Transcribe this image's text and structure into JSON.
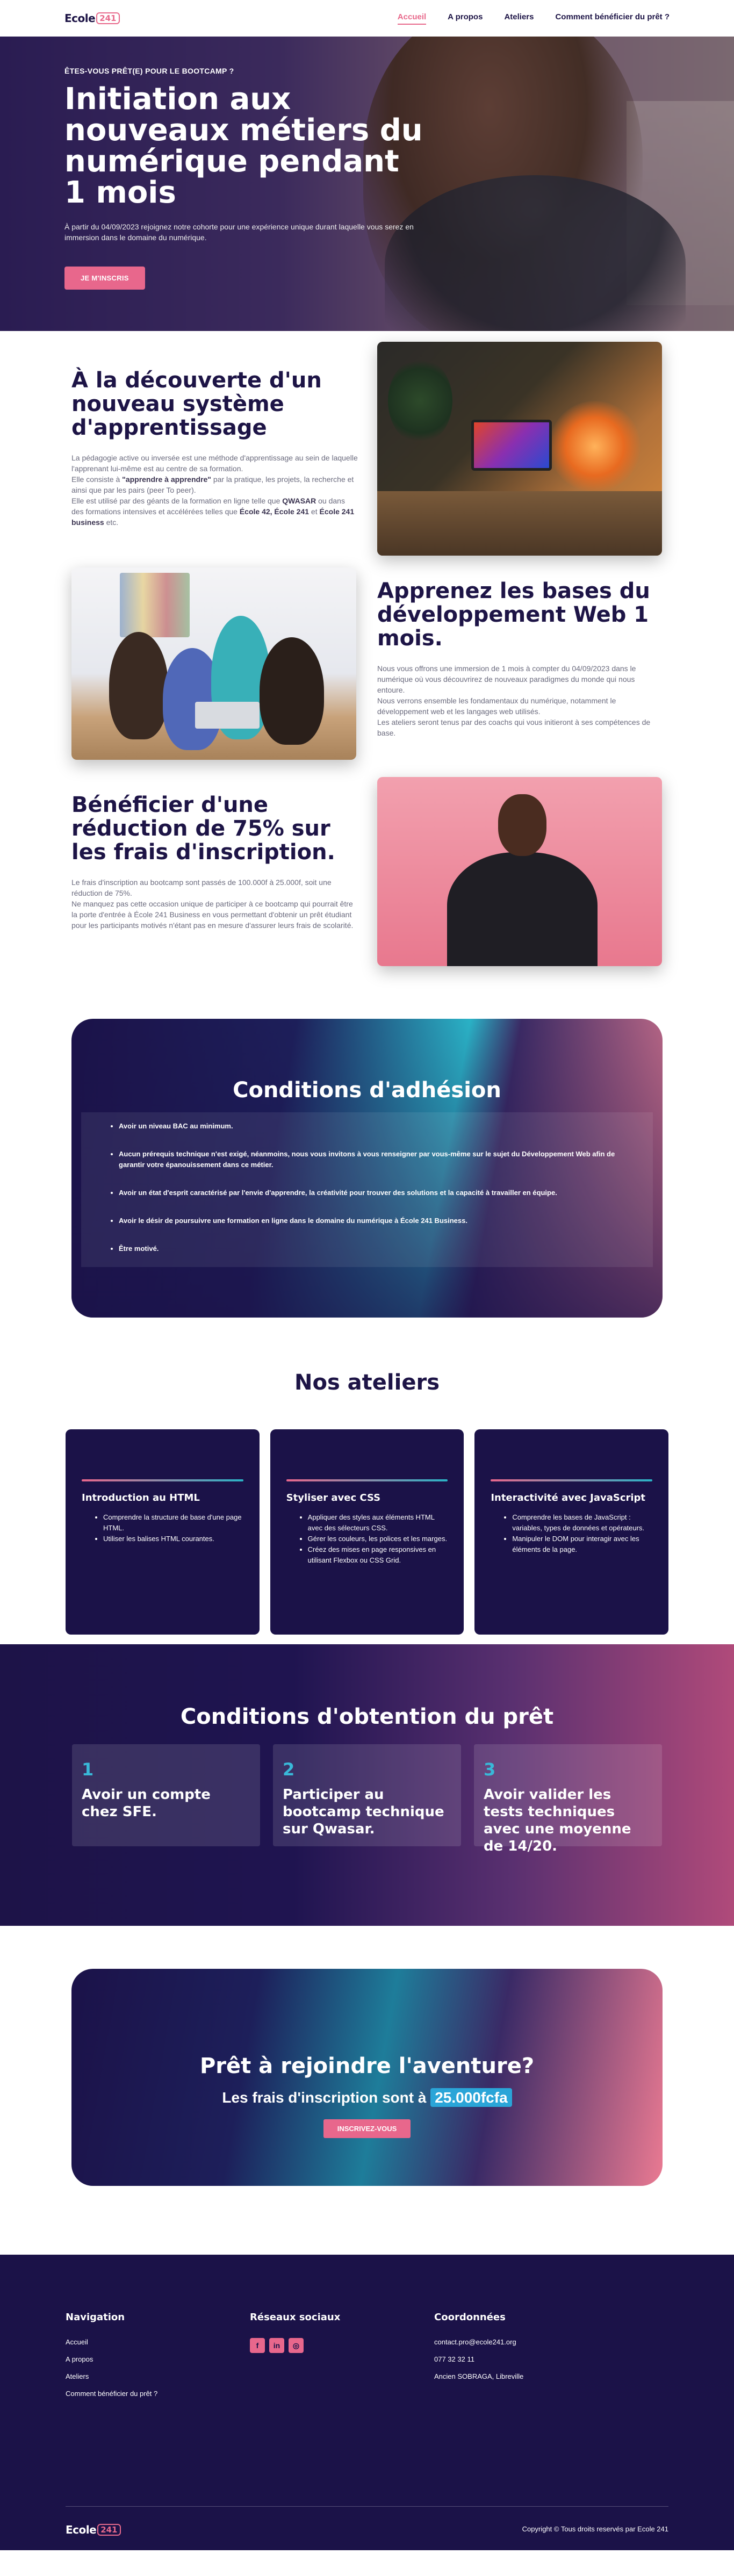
{
  "nav": {
    "logo_text": "Ecole",
    "logo_badge": "241",
    "links": [
      "Accueil",
      "A propos",
      "Ateliers",
      "Comment bénéficier du prêt ?"
    ],
    "active_index": 0
  },
  "hero": {
    "kicker": "ÊTES-VOUS PRÊT(E) POUR LE BOOTCAMP ?",
    "title": "Initiation aux nouveaux métiers du numérique pendant 1 mois",
    "description": "À partir du 04/09/2023 rejoignez notre cohorte pour une expérience unique durant laquelle vous serez en immersion dans le domaine du numérique.",
    "cta": "JE M'INSCRIS"
  },
  "feature1": {
    "title": "À la découverte d'un nouveau système d'apprentissage",
    "p1": "La pédagogie active ou inversée est une méthode d'apprentissage au sein de laquelle l'apprenant lui-même est au centre de sa formation.",
    "p2a": "Elle consiste à ",
    "p2b": "\"apprendre à apprendre\"",
    "p2c": " par la pratique, les projets, la recherche et ainsi que par les pairs (peer To peer).",
    "p3a": "Elle est utilisé par des géants de la formation en ligne telle que ",
    "p3b": "QWASAR",
    "p3c": " ou dans des formations intensives et accélérées telles que ",
    "p3d": "École 42, École 241",
    "p3e": " et ",
    "p3f": "École 241 business",
    "p3g": " etc."
  },
  "feature2": {
    "title": "Apprenez les bases du développement Web 1 mois.",
    "p1": "Nous vous offrons une immersion de 1 mois à compter du 04/09/2023 dans le numérique où vous découvrirez de nouveaux paradigmes du monde qui nous entoure.",
    "p2": "Nous verrons ensemble les fondamentaux du numérique, notamment le développement web et les langages web utilisés.",
    "p3": "Les ateliers seront tenus par des coachs qui vous initieront à ses compétences de base."
  },
  "feature3": {
    "title": "Bénéficier d'une réduction de 75% sur les frais d'inscription.",
    "p1": "Le frais d'inscription au bootcamp sont passés de 100.000f à 25.000f, soit une réduction de 75%.",
    "p2": "Ne manquez pas cette occasion unique de participer à ce bootcamp qui pourrait être la porte d'entrée à École 241 Business en vous permettant d'obtenir un prêt étudiant pour les participants motivés n'étant pas en mesure d'assurer leurs frais de scolarité."
  },
  "adhesion": {
    "title": "Conditions d'adhésion",
    "items": [
      "Avoir un niveau BAC au minimum.",
      "Aucun prérequis technique n'est exigé, néanmoins, nous vous invitons à vous renseigner par vous-même sur le sujet du Développement Web afin de garantir votre épanouissement dans ce métier.",
      "Avoir un état d'esprit caractérisé par l'envie d'apprendre, la créativité pour trouver des solutions et la capacité à travailler en équipe.",
      "Avoir le désir de poursuivre une formation en ligne dans le domaine du numérique à École 241 Business.",
      "Être motivé."
    ]
  },
  "ateliers": {
    "title": "Nos ateliers",
    "cards": [
      {
        "title": "Introduction au HTML",
        "items": [
          "Comprendre la structure de base d'une page HTML.",
          "Utiliser les balises HTML courantes."
        ]
      },
      {
        "title": "Styliser avec CSS",
        "items": [
          "Appliquer des styles aux éléments HTML avec des sélecteurs CSS.",
          "Gérer les couleurs, les polices et les marges.",
          "Créez des mises en page responsives en utilisant Flexbox ou CSS Grid."
        ]
      },
      {
        "title": "Interactivité avec JavaScript",
        "items": [
          "Comprendre les bases de JavaScript : variables, types de données et opérateurs.",
          "Manipuler le DOM pour interagir avec les éléments de la page."
        ]
      }
    ]
  },
  "pret": {
    "title": "Conditions d'obtention du prêt",
    "steps": [
      {
        "num": "1",
        "text": "Avoir un compte chez SFE."
      },
      {
        "num": "2",
        "text": "Participer au bootcamp technique sur Qwasar."
      },
      {
        "num": "3",
        "text": "Avoir valider les tests techniques avec une moyenne de 14/20."
      }
    ]
  },
  "cta": {
    "title": "Prêt à rejoindre l'aventure?",
    "fees_prefix": "Les frais d'inscription sont à ",
    "amount": "25.000fcfa",
    "button": "INSCRIVEZ-VOUS"
  },
  "footer": {
    "nav_title": "Navigation",
    "nav_links": [
      "Accueil",
      "A propos",
      "Ateliers",
      "Comment bénéficier du prêt ?"
    ],
    "social_title": "Réseaux sociaux",
    "socials": [
      "facebook-icon",
      "linkedin-icon",
      "instagram-icon"
    ],
    "contact_title": "Coordonnées",
    "email": "contact.pro@ecole241.org",
    "phone": "077 32 32 11",
    "address": "Ancien SOBRAGA, Libreville",
    "copyright": "Copyright © Tous droits reservés par Ecole 241"
  },
  "colors": {
    "accent": "#e8678c",
    "navy": "#1b1248",
    "cyan": "#2aa5d8"
  }
}
